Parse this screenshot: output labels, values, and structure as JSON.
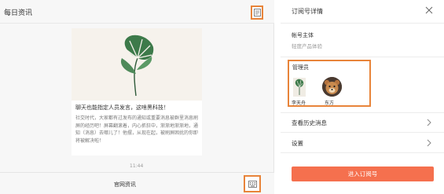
{
  "left": {
    "title": "每日资讯",
    "card": {
      "title": "聊天也能指定人员发言，这啥黑科技！",
      "body": "社交时代，大家都有过发布的通知或重要消息被群里消息刷屏的经历吧！屏幕翻滚着，内心抓狂中，渐渐地渐渐地，通知（消息）去哪儿了！他摆，从现在起，被刷屏困扰的你即将被解决啦！"
    },
    "time": "11:44",
    "footer_label": "官网资讯"
  },
  "right": {
    "title": "订阅号详情",
    "owner_label": "帐号主体",
    "owner_value": "轻度产品体验",
    "admins_label": "管理员",
    "admins": [
      {
        "name": "李天舟",
        "avatar_icon": "plant-avatar-icon"
      },
      {
        "name": "东方",
        "avatar_icon": "bear-avatar-icon"
      }
    ],
    "history_label": "查看历史消息",
    "settings_label": "设置",
    "enter_button": "进入订阅号"
  },
  "colors": {
    "accent": "#f5704e",
    "highlight_border": "#e8843a"
  },
  "icons": {
    "document": "document-icon",
    "keyboard": "keyboard-icon",
    "close": "close-icon",
    "chevron": "chevron-right-icon"
  }
}
